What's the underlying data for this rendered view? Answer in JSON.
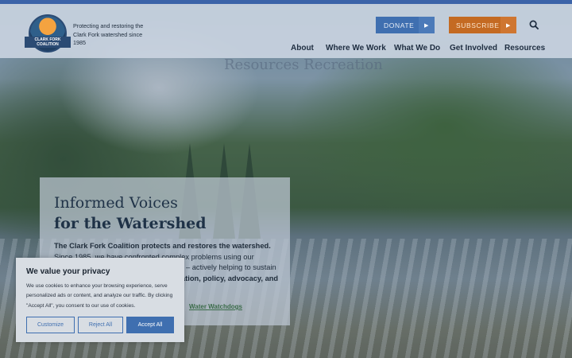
{
  "header": {
    "logo_text": "CLARK FORK COALITION",
    "tagline": "Protecting and restoring the Clark Fork watershed since 1985",
    "donate_label": "DONATE",
    "subscribe_label": "SUBSCRIBE",
    "nav": [
      {
        "label": "About"
      },
      {
        "label": "Where We Work"
      },
      {
        "label": "What We Do"
      },
      {
        "label": "Get Involved"
      },
      {
        "label": "Resources"
      }
    ]
  },
  "background_heading": "Resources Recreation",
  "hero": {
    "title_line1": "Informed Voices",
    "title_line2": "for the Watershed",
    "body_bold": "The Clark Fork Coalition protects and restores the watershed.",
    "body_rest": " Since 1985, we have confronted complex problems using our",
    "body_line3": "– actively helping to sustain",
    "body_line4": "ation, policy, advocacy, and",
    "link": "Water Watchdogs"
  },
  "cookie": {
    "title": "We value your privacy",
    "text": "We use cookies to enhance your browsing experience, serve personalized ads or content, and analyze our traffic. By clicking \"Accept All\", you consent to our use of cookies.",
    "customize_label": "Customize",
    "reject_label": "Reject All",
    "accept_label": "Accept All"
  },
  "colors": {
    "brand_blue": "#3f6fb0",
    "subscribe_orange": "#c46a22",
    "top_bar": "#3b63a8"
  },
  "icons": [
    "search-icon",
    "arrow-right-icon"
  ]
}
